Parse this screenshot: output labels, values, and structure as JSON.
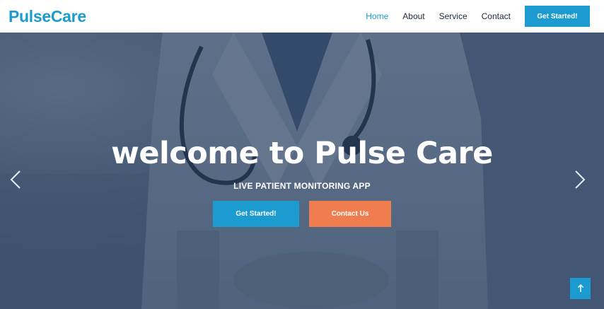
{
  "header": {
    "logo": "PulseCare",
    "nav": [
      {
        "label": "Home",
        "active": true
      },
      {
        "label": "About",
        "active": false
      },
      {
        "label": "Service",
        "active": false
      },
      {
        "label": "Contact",
        "active": false
      }
    ],
    "cta_label": "Get Started!"
  },
  "hero": {
    "title": "welcome to Pulse Care",
    "subtitle": "LIVE PATIENT MONITORING APP",
    "primary_button": "Get Started!",
    "secondary_button": "Contact Us",
    "prev_icon": "chevron-left-icon",
    "next_icon": "chevron-right-icon",
    "back_to_top_icon": "arrow-up-icon"
  },
  "colors": {
    "brand": "#1c9bd0",
    "accent": "#ef7d4f",
    "overlay": "#1e304e"
  }
}
